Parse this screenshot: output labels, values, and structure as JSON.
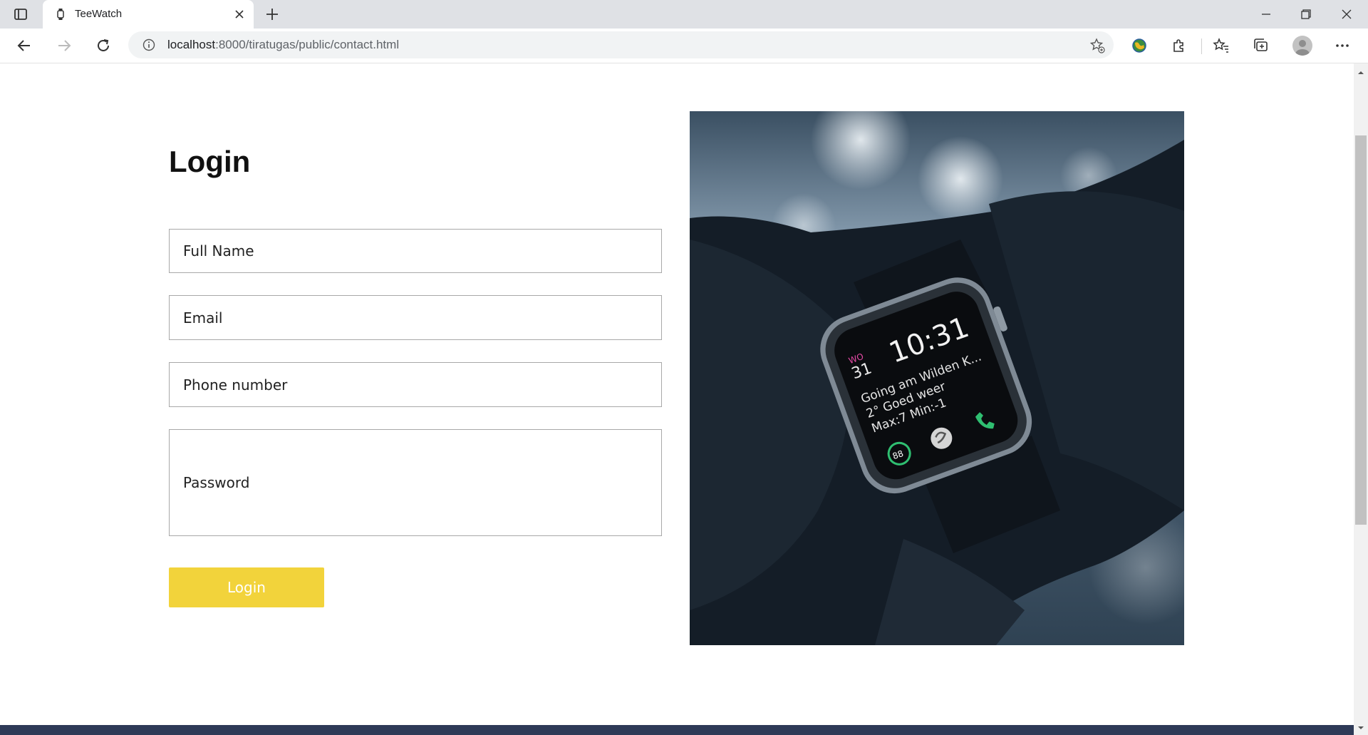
{
  "browser": {
    "tab_title": "TeeWatch",
    "url_host": "localhost",
    "url_path": ":8000/tiratugas/public/contact.html"
  },
  "page": {
    "title": "Login",
    "fields": {
      "full_name_placeholder": "Full Name",
      "email_placeholder": "Email",
      "phone_placeholder": "Phone number",
      "password_placeholder": "Password"
    },
    "login_button": "Login",
    "watch_screen": {
      "day_abbrev": "WO",
      "day_number": "31",
      "time": "10:31",
      "line1": "Going am Wilden K...",
      "line2": "2° Goed weer",
      "line3": "Max:7 Min:-1",
      "ring_value": "88"
    }
  },
  "colors": {
    "accent_button": "#f2d33b",
    "footer": "#2e3a57"
  },
  "icons": [
    "tab-actions-icon",
    "watch-favicon-icon",
    "close-icon",
    "plus-icon",
    "minimize-icon",
    "restore-icon",
    "back-arrow-icon",
    "forward-arrow-icon",
    "refresh-icon",
    "info-icon",
    "favorite-add-icon",
    "extension-icon",
    "favorites-icon",
    "collections-icon",
    "more-icon"
  ]
}
